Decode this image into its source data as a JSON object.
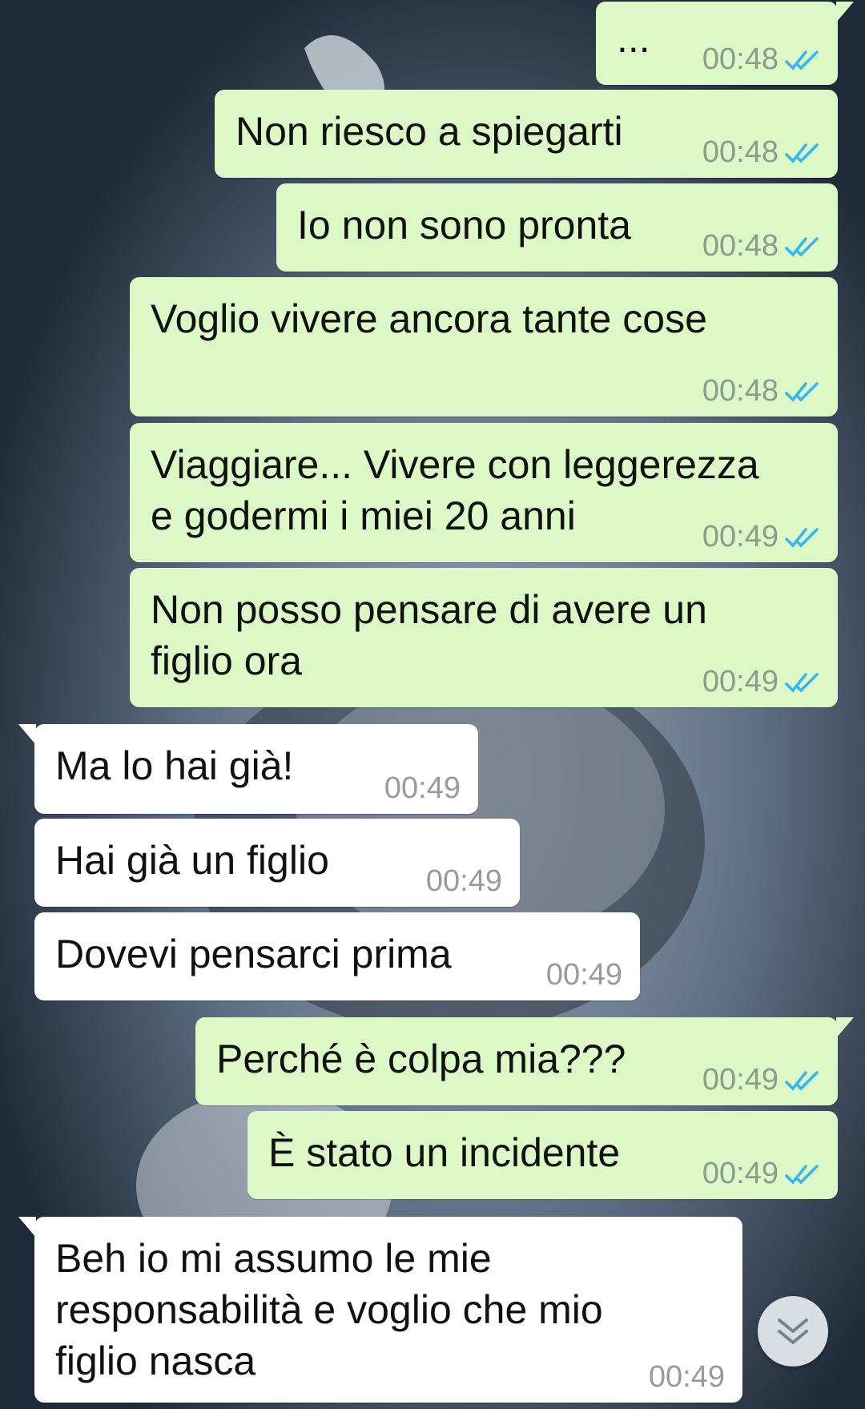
{
  "colors": {
    "outgoing_bubble": "#dcf8c6",
    "incoming_bubble": "#ffffff",
    "read_tick": "#34b7f1",
    "timestamp": "#8c9b8c"
  },
  "messages": [
    {
      "direction": "out",
      "text": "...",
      "time": "00:48",
      "status": "read-double-check-icon"
    },
    {
      "direction": "out",
      "text": "Non riesco a spiegarti",
      "time": "00:48",
      "status": "read-double-check-icon"
    },
    {
      "direction": "out",
      "text": "Io non sono pronta",
      "time": "00:48",
      "status": "read-double-check-icon"
    },
    {
      "direction": "out",
      "text": "Voglio vivere ancora tante cose",
      "time": "00:48",
      "status": "read-double-check-icon"
    },
    {
      "direction": "out",
      "lines": [
        "Viaggiare... Vivere con leggerezza",
        "e godermi i miei 20 anni"
      ],
      "time": "00:49",
      "status": "read-double-check-icon"
    },
    {
      "direction": "out",
      "lines": [
        "Non posso pensare di avere un",
        "figlio ora"
      ],
      "time": "00:49",
      "status": "read-double-check-icon"
    },
    {
      "direction": "in",
      "text": "Ma lo hai già!",
      "time": "00:49"
    },
    {
      "direction": "in",
      "text": "Hai già un figlio",
      "time": "00:49"
    },
    {
      "direction": "in",
      "text": "Dovevi pensarci prima",
      "time": "00:49"
    },
    {
      "direction": "out",
      "text": "Perché è colpa mia???",
      "time": "00:49",
      "status": "read-double-check-icon"
    },
    {
      "direction": "out",
      "text": "È stato un incidente",
      "time": "00:49",
      "status": "read-double-check-icon"
    },
    {
      "direction": "in",
      "lines": [
        "Beh io mi assumo le mie",
        "responsabilità e voglio che mio",
        "figlio nasca"
      ],
      "time": "00:49"
    }
  ],
  "scroll_button": {
    "icon": "double-chevron-down-icon"
  }
}
